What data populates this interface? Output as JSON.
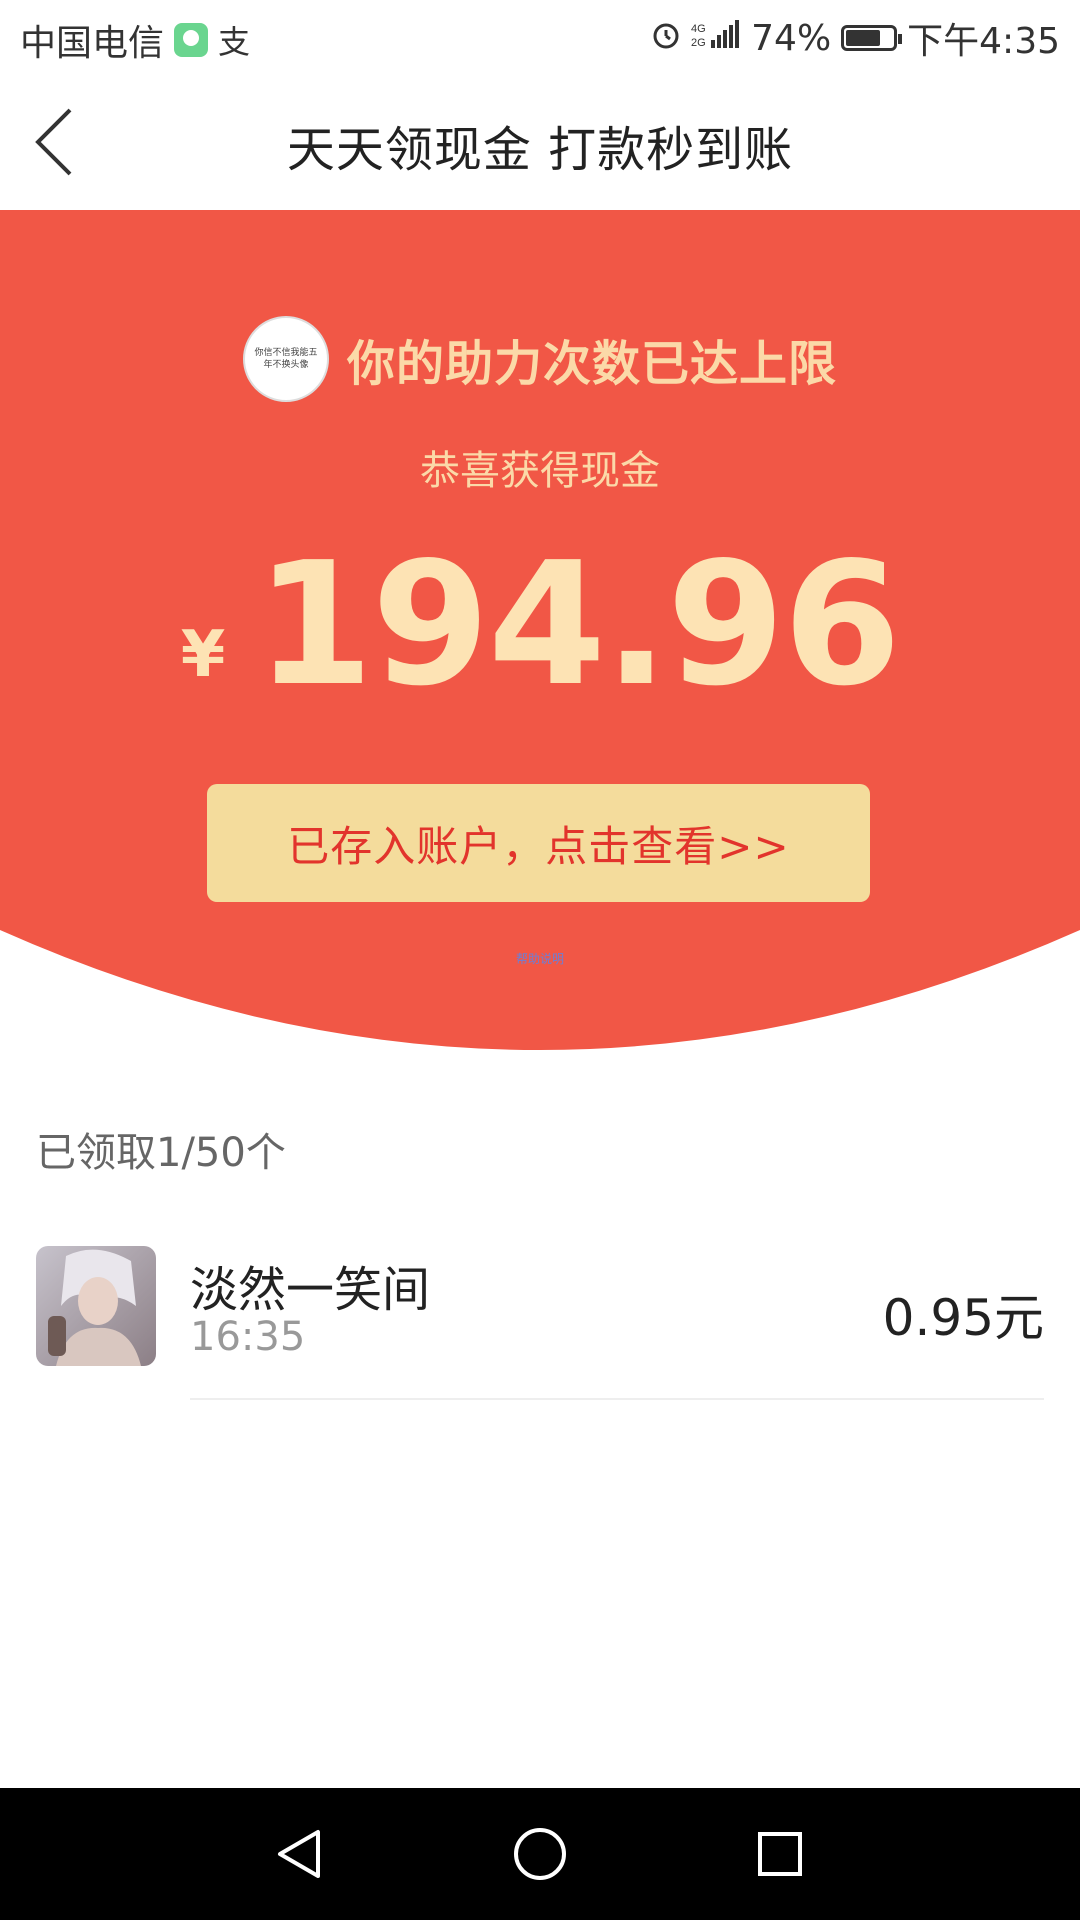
{
  "status_bar": {
    "carrier": "中国电信",
    "network": "4G 2G",
    "battery_percent": "74%",
    "battery_level": 0.74,
    "time": "下午4:35",
    "icons": [
      "chat-app-icon",
      "alipay-icon",
      "alarm-icon",
      "signal-icon",
      "battery-icon"
    ]
  },
  "header": {
    "title": "天天领现金 打款秒到账",
    "back_icon": "chevron-left-icon"
  },
  "reward_panel": {
    "avatar_caption": "你信不信我能五年不换头像",
    "helper_title": "你的助力次数已达上限",
    "congrats": "恭喜获得现金",
    "currency": "¥",
    "amount": "194.96",
    "button_label": "已存入账户，点击查看>>",
    "tiny_link": "帮助说明",
    "colors": {
      "red": "#f15746",
      "button_bg": "#f4dc9c",
      "button_text": "#e2342c",
      "gold_text": "#fde3b4"
    }
  },
  "claimed": {
    "count_label": "已领取1/50个",
    "items": [
      {
        "name": "淡然一笑间",
        "time": "16:35",
        "amount": "0.95元"
      }
    ]
  },
  "nav_bar": {
    "icons": [
      "back-triangle-icon",
      "home-circle-icon",
      "recents-square-icon"
    ]
  }
}
